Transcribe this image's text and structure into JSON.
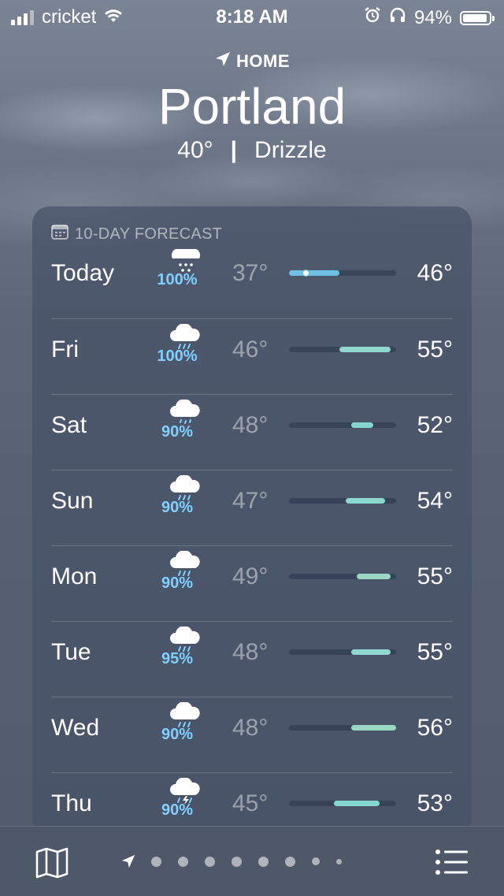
{
  "status_bar": {
    "carrier": "cricket",
    "time": "8:18 AM",
    "battery_pct": "94%"
  },
  "header": {
    "home_label": "HOME",
    "city": "Portland",
    "current_temp": "40°",
    "separator": "|",
    "condition": "Drizzle"
  },
  "forecast": {
    "title": "10-DAY FORECAST",
    "range_min": 37,
    "range_max": 56,
    "days": [
      {
        "day": "Today",
        "icon": "snow-cloud-icon",
        "precip": "100%",
        "low": "37°",
        "high": "46°",
        "low_val": 37,
        "high_val": 46,
        "current_val": 40,
        "bar_color": "#6ec1e4"
      },
      {
        "day": "Fri",
        "icon": "rain-cloud-icon",
        "precip": "100%",
        "low": "46°",
        "high": "55°",
        "low_val": 46,
        "high_val": 55,
        "bar_color": "#8fd7cf"
      },
      {
        "day": "Sat",
        "icon": "drizzle-cloud-icon",
        "precip": "90%",
        "low": "48°",
        "high": "52°",
        "low_val": 48,
        "high_val": 52,
        "bar_color": "#86d6d0"
      },
      {
        "day": "Sun",
        "icon": "rain-cloud-icon",
        "precip": "90%",
        "low": "47°",
        "high": "54°",
        "low_val": 47,
        "high_val": 54,
        "bar_color": "#8ad8cf"
      },
      {
        "day": "Mon",
        "icon": "rain-cloud-icon",
        "precip": "90%",
        "low": "49°",
        "high": "55°",
        "low_val": 49,
        "high_val": 55,
        "bar_color": "#9ad8c4"
      },
      {
        "day": "Tue",
        "icon": "rain-cloud-icon",
        "precip": "95%",
        "low": "48°",
        "high": "55°",
        "low_val": 48,
        "high_val": 55,
        "bar_color": "#8fd7cf"
      },
      {
        "day": "Wed",
        "icon": "rain-cloud-icon",
        "precip": "90%",
        "low": "48°",
        "high": "56°",
        "low_val": 48,
        "high_val": 56,
        "bar_color": "#9ad8c4"
      },
      {
        "day": "Thu",
        "icon": "thunderstorm-cloud-icon",
        "precip": "90%",
        "low": "45°",
        "high": "53°",
        "low_val": 45,
        "high_val": 53,
        "bar_color": "#86d6d0"
      }
    ]
  },
  "toolbar": {
    "map_icon": "map-icon",
    "list_icon": "list-icon",
    "page_count": 9,
    "current_page": 0
  }
}
